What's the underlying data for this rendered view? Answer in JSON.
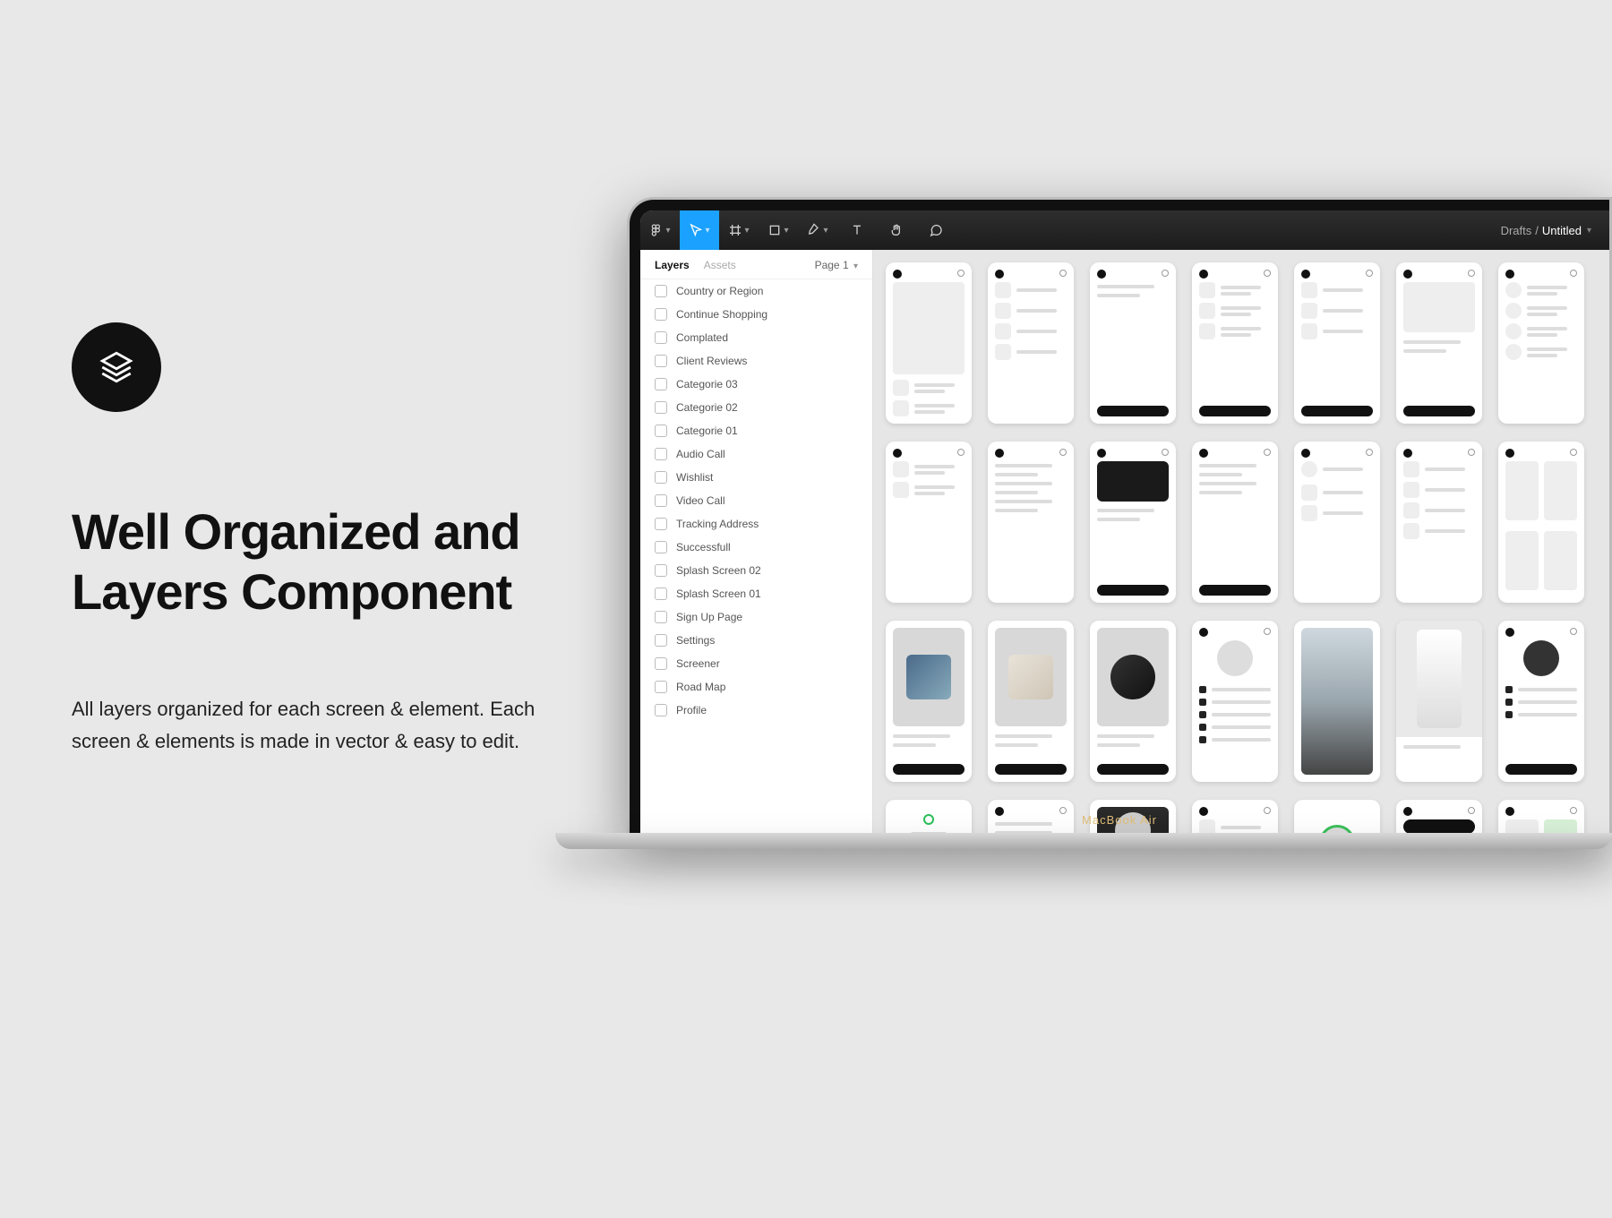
{
  "promo": {
    "title": "Well Organized and Layers Component",
    "desc": "All layers organized for each screen & element. Each screen & elements is made in vector & easy to edit."
  },
  "device": {
    "brand": "MacBook Air"
  },
  "figma": {
    "breadcrumb": {
      "parent": "Drafts",
      "current": "Untitled"
    },
    "tools": [
      "logo",
      "move",
      "frame",
      "shape",
      "pen",
      "text",
      "hand",
      "comment"
    ],
    "sidebar": {
      "tabs": {
        "layers": "Layers",
        "assets": "Assets"
      },
      "page_label": "Page 1",
      "items": [
        "Country or Region",
        "Continue Shopping",
        "Complated",
        "Client Reviews",
        "Categorie 03",
        "Categorie 02",
        "Categorie 01",
        "Audio Call",
        "Wishlist",
        "Video Call",
        "Tracking Address",
        "Successfull",
        "Splash Screen 02",
        "Splash Screen 01",
        "Sign Up Page",
        "Settings",
        "Screener",
        "Road Map",
        "Profile"
      ]
    },
    "artboards": 28
  }
}
